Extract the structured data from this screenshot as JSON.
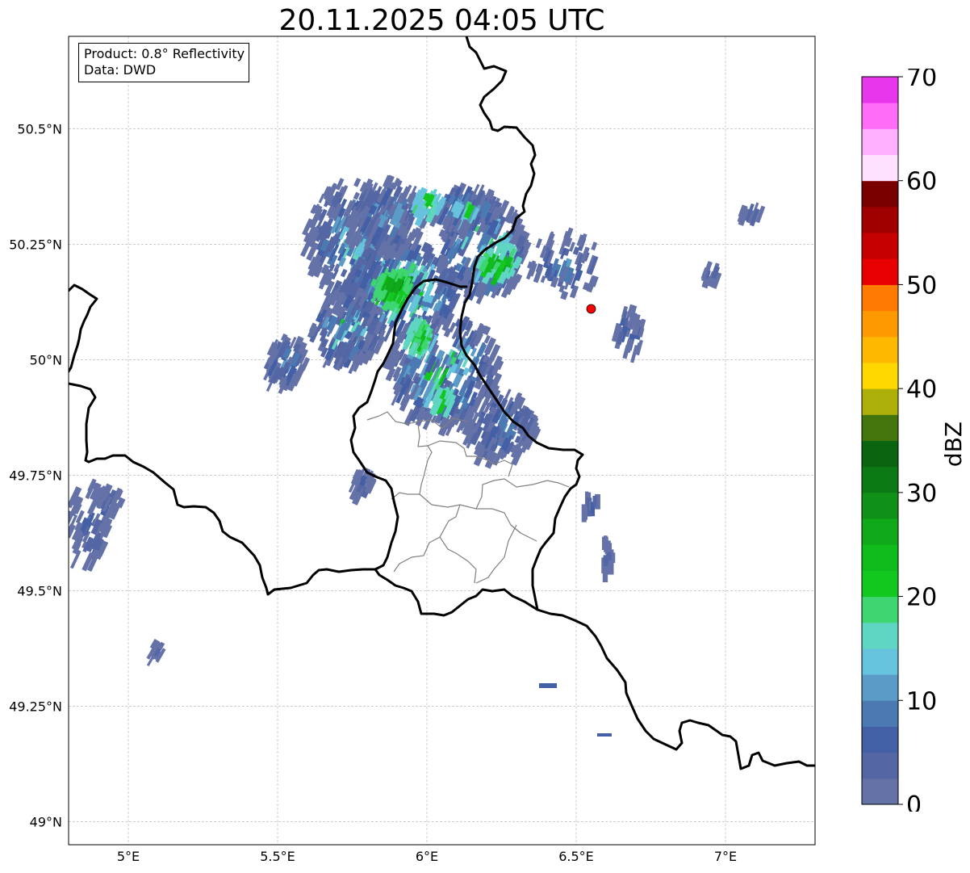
{
  "title": "20.11.2025 04:05 UTC",
  "info": {
    "product": "Product: 0.8° Reflectivity",
    "data": "Data: DWD"
  },
  "map": {
    "lon_range": [
      4.8,
      7.3
    ],
    "lat_range": [
      48.95,
      50.7
    ],
    "lon_ticks": [
      {
        "value": 5.0,
        "label": "5°E"
      },
      {
        "value": 5.5,
        "label": "5.5°E"
      },
      {
        "value": 6.0,
        "label": "6°E"
      },
      {
        "value": 6.5,
        "label": "6.5°E"
      },
      {
        "value": 7.0,
        "label": "7°E"
      }
    ],
    "lat_ticks": [
      {
        "value": 49.0,
        "label": "49°N"
      },
      {
        "value": 49.25,
        "label": "49.25°N"
      },
      {
        "value": 49.5,
        "label": "49.5°N"
      },
      {
        "value": 49.75,
        "label": "49.75°N"
      },
      {
        "value": 50.0,
        "label": "50°N"
      },
      {
        "value": 50.25,
        "label": "50.25°N"
      },
      {
        "value": 50.5,
        "label": "50.5°N"
      }
    ],
    "grid": true,
    "marker": {
      "lon": 6.55,
      "lat": 50.11,
      "color": "#ff0000"
    }
  },
  "colorbar": {
    "label": "dBZ",
    "min": 0,
    "max": 70,
    "step": 2.5,
    "ticks": [
      {
        "value": 0,
        "label": "0"
      },
      {
        "value": 10,
        "label": "10"
      },
      {
        "value": 20,
        "label": "20"
      },
      {
        "value": 30,
        "label": "30"
      },
      {
        "value": 40,
        "label": "40"
      },
      {
        "value": 50,
        "label": "50"
      },
      {
        "value": 60,
        "label": "60"
      },
      {
        "value": 70,
        "label": "70"
      }
    ],
    "colors": [
      "#6472a8",
      "#5467a4",
      "#435fa5",
      "#4b7ab3",
      "#5b9bc8",
      "#66c3de",
      "#5fd5c3",
      "#3ed671",
      "#12c81e",
      "#10bb1c",
      "#10a919",
      "#0f9117",
      "#0c7a14",
      "#0a6410",
      "#42760c",
      "#aeae08",
      "#ffd800",
      "#ffb800",
      "#ff9900",
      "#ff7a00",
      "#e80000",
      "#c60000",
      "#a00000",
      "#780000",
      "#ffe0ff",
      "#ffb0ff",
      "#ff6cf8",
      "#e836ec"
    ]
  }
}
